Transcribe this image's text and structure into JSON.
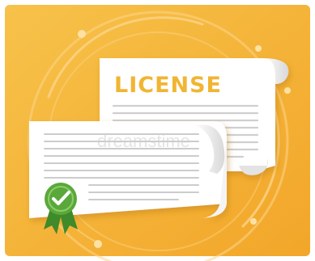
{
  "illustration": {
    "title": "LICENSE",
    "watermark": "dreamstime",
    "icons": [
      "document-icon",
      "certificate-icon",
      "check-badge-icon",
      "ribbon-icon"
    ],
    "colors": {
      "background": "#f3ac2e",
      "background_light": "#f7c24a",
      "paper": "#ffffff",
      "paper_shade": "#e6e6e6",
      "text_lines": "#c9c9c9",
      "title": "#f1b533",
      "badge_green": "#5aa83a",
      "badge_dark": "#3f8a2a",
      "rings": "#fbd58a"
    }
  }
}
